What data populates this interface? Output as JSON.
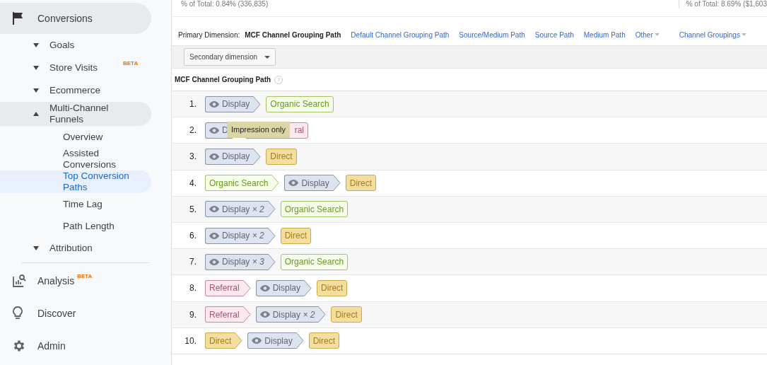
{
  "sidebar": {
    "items": [
      {
        "label": "Conversions",
        "expanded": true,
        "selected": false,
        "children": [
          {
            "label": "Goals",
            "expanded": false,
            "selected": false
          },
          {
            "label": "Store Visits",
            "badge": "BETA",
            "expanded": false,
            "selected": false
          },
          {
            "label": "Ecommerce",
            "expanded": false,
            "selected": false
          },
          {
            "label": "Multi-Channel Funnels",
            "expanded": true,
            "selected": false,
            "children": [
              {
                "label": "Overview",
                "selected": false
              },
              {
                "label": "Assisted Conversions",
                "selected": false
              },
              {
                "label": "Top Conversion Paths",
                "selected": true
              },
              {
                "label": "Time Lag",
                "selected": false
              },
              {
                "label": "Path Length",
                "selected": false
              }
            ]
          },
          {
            "label": "Attribution",
            "expanded": false,
            "selected": false
          }
        ]
      },
      {
        "label": "Analysis",
        "badge": "BETA",
        "selected": false
      },
      {
        "label": "Discover",
        "selected": false
      },
      {
        "label": "Admin",
        "selected": false
      }
    ]
  },
  "summary": [
    "% of Total: 0.84% (336,835)",
    "% of Total: 8.69% ($1,603"
  ],
  "primary_dimension": {
    "label": "Primary Dimension:",
    "options": [
      {
        "label": "MCF Channel Grouping Path",
        "selected": true,
        "dropdown": false
      },
      {
        "label": "Default Channel Grouping Path",
        "selected": false,
        "dropdown": false
      },
      {
        "label": "Source/Medium Path",
        "selected": false,
        "dropdown": false
      },
      {
        "label": "Source Path",
        "selected": false,
        "dropdown": false
      },
      {
        "label": "Medium Path",
        "selected": false,
        "dropdown": false
      },
      {
        "label": "Other",
        "selected": false,
        "dropdown": true
      },
      {
        "label": "Channel Groupings",
        "selected": false,
        "dropdown": true
      }
    ]
  },
  "secondary_dimension": {
    "label": "Secondary dimension"
  },
  "table": {
    "column": "MCF Channel Grouping Path",
    "help": "?",
    "rows": [
      {
        "index": "1.",
        "steps": [
          {
            "kind": "display",
            "text": "Display"
          },
          {
            "kind": "organic",
            "text": "Organic Search"
          }
        ]
      },
      {
        "index": "2.",
        "steps": [
          {
            "kind": "display",
            "text": "D"
          },
          {
            "kind": "referral",
            "text": "ral"
          }
        ],
        "tooltip": "Impression only"
      },
      {
        "index": "3.",
        "steps": [
          {
            "kind": "display",
            "text": "Display"
          },
          {
            "kind": "direct",
            "text": "Direct"
          }
        ]
      },
      {
        "index": "4.",
        "steps": [
          {
            "kind": "organic",
            "text": "Organic Search"
          },
          {
            "kind": "display",
            "text": "Display"
          },
          {
            "kind": "direct",
            "text": "Direct"
          }
        ]
      },
      {
        "index": "5.",
        "steps": [
          {
            "kind": "display",
            "text": "Display *× 2*"
          },
          {
            "kind": "organic",
            "text": "Organic Search"
          }
        ]
      },
      {
        "index": "6.",
        "steps": [
          {
            "kind": "display",
            "text": "Display *× 2*"
          },
          {
            "kind": "direct",
            "text": "Direct"
          }
        ]
      },
      {
        "index": "7.",
        "steps": [
          {
            "kind": "display",
            "text": "Display *× 3*"
          },
          {
            "kind": "organic",
            "text": "Organic Search"
          }
        ]
      },
      {
        "index": "8.",
        "steps": [
          {
            "kind": "referral",
            "text": "Referral"
          },
          {
            "kind": "display",
            "text": "Display"
          },
          {
            "kind": "direct",
            "text": "Direct"
          }
        ]
      },
      {
        "index": "9.",
        "steps": [
          {
            "kind": "referral",
            "text": "Referral"
          },
          {
            "kind": "display",
            "text": "Display *× 2*"
          },
          {
            "kind": "direct",
            "text": "Direct"
          }
        ]
      },
      {
        "index": "10.",
        "steps": [
          {
            "kind": "direct",
            "text": "Direct"
          },
          {
            "kind": "display",
            "text": "Display"
          },
          {
            "kind": "direct",
            "text": "Direct"
          }
        ]
      }
    ]
  }
}
